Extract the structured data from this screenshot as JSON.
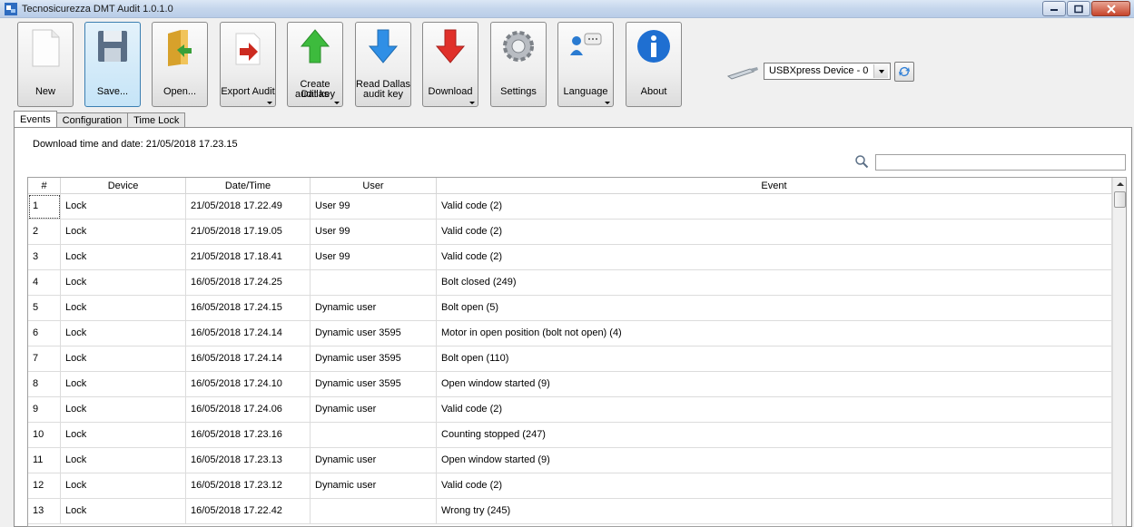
{
  "window": {
    "title": "Tecnosicurezza DMT Audit 1.0.1.0"
  },
  "toolbar": {
    "new": "New",
    "save": "Save...",
    "open": "Open...",
    "export_audit": "Export Audit",
    "create_dallas_line1": "Create Dallas",
    "create_dallas_line2": "audit key",
    "read_dallas_line1": "Read Dallas",
    "read_dallas_line2": "audit key",
    "download": "Download",
    "settings": "Settings",
    "language": "Language",
    "about": "About"
  },
  "device": {
    "selected": "USBXpress Device - 0"
  },
  "tabs": [
    {
      "label": "Events"
    },
    {
      "label": "Configuration"
    },
    {
      "label": "Time Lock"
    }
  ],
  "events": {
    "download_time": "Download time and date: 21/05/2018 17.23.15",
    "search_placeholder": "",
    "columns": [
      "#",
      "Device",
      "Date/Time",
      "User",
      "Event"
    ],
    "rows": [
      {
        "n": "1",
        "device": "Lock",
        "datetime": "21/05/2018 17.22.49",
        "user": "User 99",
        "event": "Valid code (2)"
      },
      {
        "n": "2",
        "device": "Lock",
        "datetime": "21/05/2018 17.19.05",
        "user": "User 99",
        "event": "Valid code (2)"
      },
      {
        "n": "3",
        "device": "Lock",
        "datetime": "21/05/2018 17.18.41",
        "user": "User 99",
        "event": "Valid code (2)"
      },
      {
        "n": "4",
        "device": "Lock",
        "datetime": "16/05/2018 17.24.25",
        "user": "",
        "event": "Bolt closed (249)"
      },
      {
        "n": "5",
        "device": "Lock",
        "datetime": "16/05/2018 17.24.15",
        "user": "Dynamic user",
        "event": "Bolt open (5)"
      },
      {
        "n": "6",
        "device": "Lock",
        "datetime": "16/05/2018 17.24.14",
        "user": "Dynamic user 3595",
        "event": "Motor in open position (bolt not open) (4)"
      },
      {
        "n": "7",
        "device": "Lock",
        "datetime": "16/05/2018 17.24.14",
        "user": "Dynamic user 3595",
        "event": "Bolt open (110)"
      },
      {
        "n": "8",
        "device": "Lock",
        "datetime": "16/05/2018 17.24.10",
        "user": "Dynamic user 3595",
        "event": "Open window started (9)"
      },
      {
        "n": "9",
        "device": "Lock",
        "datetime": "16/05/2018 17.24.06",
        "user": "Dynamic user",
        "event": "Valid code (2)"
      },
      {
        "n": "10",
        "device": "Lock",
        "datetime": "16/05/2018 17.23.16",
        "user": "",
        "event": "Counting stopped (247)"
      },
      {
        "n": "11",
        "device": "Lock",
        "datetime": "16/05/2018 17.23.13",
        "user": "Dynamic user",
        "event": "Open window started (9)"
      },
      {
        "n": "12",
        "device": "Lock",
        "datetime": "16/05/2018 17.23.12",
        "user": "Dynamic user",
        "event": "Valid code (2)"
      },
      {
        "n": "13",
        "device": "Lock",
        "datetime": "16/05/2018 17.22.42",
        "user": "",
        "event": "Wrong try (245)"
      }
    ]
  }
}
